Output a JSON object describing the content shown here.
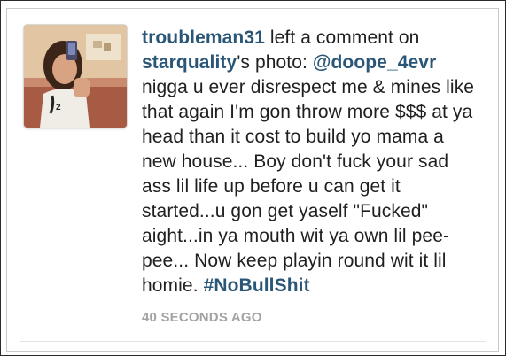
{
  "notification": {
    "actor_username": "troubleman31",
    "action_text": " left a comment on ",
    "owner_username": "starquality",
    "owner_suffix": "'s photo: ",
    "mention": "@doope_4evr",
    "comment_body": "nigga u ever disrespect me & mines like that again I'm gon throw more $$$ at ya head than it cost to build yo mama a new house... Boy don't fuck your sad ass lil life up before u can get it started...u gon get yaself \"Fucked\" aight...in ya mouth wit ya own lil pee-pee... Now keep playin round wit it lil homie. ",
    "hashtag": "#NoBullShit",
    "timestamp": "40 SECONDS AGO"
  },
  "colors": {
    "link": "#2a5677",
    "text": "#1f1f1f",
    "timestamp": "#a3a3a3"
  },
  "icons": {
    "avatar": "user-avatar-photo"
  }
}
